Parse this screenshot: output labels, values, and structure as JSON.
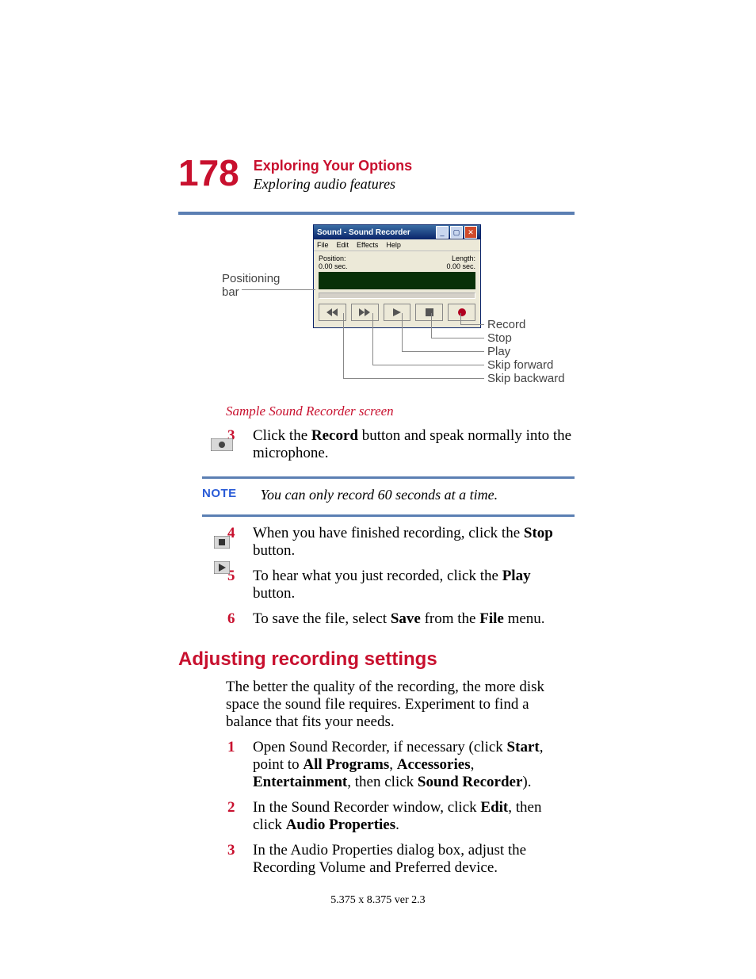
{
  "header": {
    "page_number": "178",
    "chapter": "Exploring Your Options",
    "section": "Exploring audio features"
  },
  "sound_recorder": {
    "title": "Sound - Sound Recorder",
    "menus": [
      "File",
      "Edit",
      "Effects",
      "Help"
    ],
    "position_label": "Position:",
    "position_value": "0.00 sec.",
    "length_label": "Length:",
    "length_value": "0.00 sec."
  },
  "callouts": {
    "positioning_bar": "Positioning",
    "positioning_bar2": "bar",
    "record": "Record",
    "stop": "Stop",
    "play": "Play",
    "skip_forward": "Skip forward",
    "skip_backward": "Skip backward"
  },
  "caption": "Sample Sound Recorder screen",
  "steps_a": {
    "s3_num": "3",
    "s3_text_a": "Click the ",
    "s3_text_b": "Record",
    "s3_text_c": " button and speak normally into the microphone."
  },
  "note": {
    "label": "NOTE",
    "text": "You can only record 60 seconds at a time."
  },
  "steps_b": {
    "s4_num": "4",
    "s4_a": "When you have finished recording, click the ",
    "s4_b": "Stop",
    "s4_c": " button.",
    "s5_num": "5",
    "s5_a": "To hear what you just recorded, click the ",
    "s5_b": "Play",
    "s5_c": " button.",
    "s6_num": "6",
    "s6_a": "To save the file, select ",
    "s6_b": "Save",
    "s6_c": " from the ",
    "s6_d": "File",
    "s6_e": " menu."
  },
  "section_heading": "Adjusting recording settings",
  "para1": "The better the quality of the recording, the more disk space the sound file requires. Experiment to find a balance that fits your needs.",
  "steps_c": {
    "s1_num": "1",
    "s1_a": "Open Sound Recorder, if necessary (click ",
    "s1_b": "Start",
    "s1_c": ", point to ",
    "s1_d": "All Programs",
    "s1_e": ", ",
    "s1_f": "Accessories",
    "s1_g": ", ",
    "s1_h": "Entertainment",
    "s1_i": ", then click ",
    "s1_j": "Sound Recorder",
    "s1_k": ").",
    "s2_num": "2",
    "s2_a": "In the Sound Recorder window, click ",
    "s2_b": "Edit",
    "s2_c": ", then click ",
    "s2_d": "Audio Properties",
    "s2_e": ".",
    "s3_num": "3",
    "s3_a": "In the Audio Properties dialog box, adjust the Recording Volume and Preferred device."
  },
  "footer": "5.375 x 8.375 ver 2.3"
}
